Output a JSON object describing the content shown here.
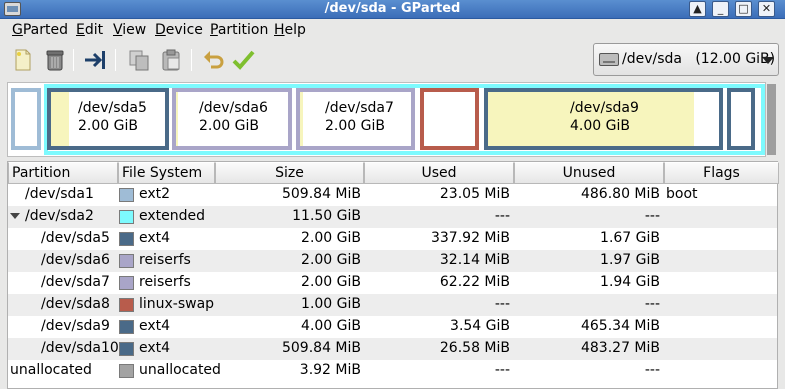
{
  "window": {
    "title": "/dev/sda - GParted"
  },
  "menubar": {
    "items": [
      {
        "pre": "",
        "key": "G",
        "post": "Parted"
      },
      {
        "pre": "",
        "key": "E",
        "post": "dit"
      },
      {
        "pre": "",
        "key": "V",
        "post": "iew"
      },
      {
        "pre": "",
        "key": "D",
        "post": "evice"
      },
      {
        "pre": "",
        "key": "P",
        "post": "artition"
      },
      {
        "pre": "",
        "key": "H",
        "post": "elp"
      }
    ]
  },
  "toolbar": {
    "icons": [
      "new-partition-icon",
      "delete-icon",
      "resize-move-icon",
      "copy-icon",
      "paste-icon",
      "undo-icon",
      "apply-icon"
    ]
  },
  "device_selector": {
    "label": "/dev/sda   (12.00 GiB)"
  },
  "disk_map": {
    "partitions": [
      {
        "name": "",
        "size": "",
        "border": "#9fbcd6",
        "used_fraction": 0
      },
      {
        "name": "/dev/sda5",
        "size": "2.00 GiB",
        "border": "#4a6a88",
        "used_fraction": 0.16
      },
      {
        "name": "/dev/sda6",
        "size": "2.00 GiB",
        "border": "#a9a5c8",
        "used_fraction": 0.02
      },
      {
        "name": "/dev/sda7",
        "size": "2.00 GiB",
        "border": "#a9a5c8",
        "used_fraction": 0.03
      },
      {
        "name": "",
        "size": "",
        "border": "#b85c4c",
        "used_fraction": 0
      },
      {
        "name": "/dev/sda9",
        "size": "4.00 GiB",
        "border": "#4a6a88",
        "used_fraction": 0.89
      },
      {
        "name": "",
        "size": "",
        "border": "#4a6a88",
        "used_fraction": 0
      }
    ],
    "extended_color": "#7dfafe"
  },
  "table": {
    "columns": [
      "Partition",
      "File System",
      "Size",
      "Used",
      "Unused",
      "Flags"
    ],
    "rows": [
      {
        "partition": "/dev/sda1",
        "fs": "ext2",
        "color": "#9fbcd6",
        "size": "509.84 MiB",
        "used": "23.05 MiB",
        "unused": "486.80 MiB",
        "flags": "boot",
        "level": 0
      },
      {
        "partition": "/dev/sda2",
        "fs": "extended",
        "color": "#7dfafe",
        "size": "11.50 GiB",
        "used": "---",
        "unused": "---",
        "flags": "",
        "level": 0,
        "expanded": true
      },
      {
        "partition": "/dev/sda5",
        "fs": "ext4",
        "color": "#4a6a88",
        "size": "2.00 GiB",
        "used": "337.92 MiB",
        "unused": "1.67 GiB",
        "flags": "",
        "level": 1
      },
      {
        "partition": "/dev/sda6",
        "fs": "reiserfs",
        "color": "#a9a5c8",
        "size": "2.00 GiB",
        "used": "32.14 MiB",
        "unused": "1.97 GiB",
        "flags": "",
        "level": 1
      },
      {
        "partition": "/dev/sda7",
        "fs": "reiserfs",
        "color": "#a9a5c8",
        "size": "2.00 GiB",
        "used": "62.22 MiB",
        "unused": "1.94 GiB",
        "flags": "",
        "level": 1
      },
      {
        "partition": "/dev/sda8",
        "fs": "linux-swap",
        "color": "#b85c4c",
        "size": "1.00 GiB",
        "used": "---",
        "unused": "---",
        "flags": "",
        "level": 1
      },
      {
        "partition": "/dev/sda9",
        "fs": "ext4",
        "color": "#4a6a88",
        "size": "4.00 GiB",
        "used": "3.54 GiB",
        "unused": "465.34 MiB",
        "flags": "",
        "level": 1
      },
      {
        "partition": "/dev/sda10",
        "fs": "ext4",
        "color": "#4a6a88",
        "size": "509.84 MiB",
        "used": "26.58 MiB",
        "unused": "483.27 MiB",
        "flags": "",
        "level": 1
      },
      {
        "partition": "unallocated",
        "fs": "unallocated",
        "color": "#a3a3a3",
        "size": "3.92 MiB",
        "used": "---",
        "unused": "---",
        "flags": "",
        "level": 0
      }
    ]
  }
}
